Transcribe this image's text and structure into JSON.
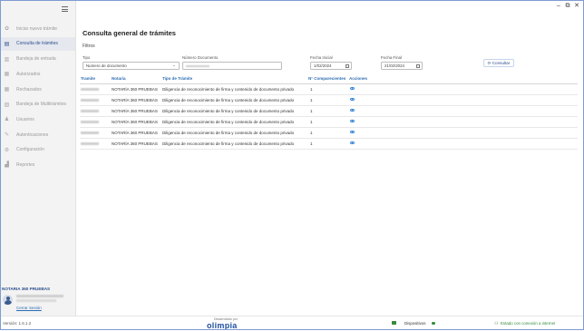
{
  "window": {
    "minimize": "–",
    "maximize": "⧉",
    "close": "✕"
  },
  "sidebar": {
    "items": [
      {
        "label": "Iniciar nuevo trámite",
        "icon": "gear-plus-icon",
        "glyph": "✿",
        "active": false
      },
      {
        "label": "Consulta de trámites",
        "icon": "table-icon",
        "glyph": "▤",
        "active": true
      },
      {
        "label": "Bandeja de entrada",
        "icon": "inbox-icon",
        "glyph": "▥",
        "active": false
      },
      {
        "label": "Autorizados",
        "icon": "document-check-icon",
        "glyph": "▦",
        "active": false
      },
      {
        "label": "Rechazados",
        "icon": "document-x-icon",
        "glyph": "▦",
        "active": false
      },
      {
        "label": "Bandeja de Multitrámites",
        "icon": "documents-icon",
        "glyph": "▧",
        "active": false
      },
      {
        "label": "Usuarios",
        "icon": "user-icon",
        "glyph": "♟",
        "active": false
      },
      {
        "label": "Autenticaciones",
        "icon": "fingerprint-icon",
        "glyph": "✎",
        "active": false
      },
      {
        "label": "Configuración",
        "icon": "gear-icon",
        "glyph": "⚙",
        "active": false
      },
      {
        "label": "Reportes",
        "icon": "bar-chart-icon",
        "glyph": "▟",
        "active": false
      }
    ],
    "user": {
      "notary": "NOTARIA 360 PRUEBAS",
      "logout": "Cerrar Sesión"
    }
  },
  "main": {
    "title": "Consulta general de trámites",
    "filters_label": "Filtros",
    "filters": {
      "tipo_label": "Tipo",
      "tipo_value": "Numero de documento",
      "numero_label": "Número Documento",
      "fecha_inicial_label": "Fecha Inicial",
      "fecha_inicial_value": "1/02/2024",
      "fecha_final_label": "Fecha Final",
      "fecha_final_value": "21/02/2024",
      "consult_button": "Consultar"
    },
    "table": {
      "headers": [
        "Tramite",
        "Notaria",
        "Tipo de Trámite",
        "N° Comparecientes",
        "Acciones"
      ],
      "rows": [
        {
          "notaria": "NOTARÍA 360 PRUEBAS",
          "tipo": "Diligencia de reconocimiento de firma y contenido de documento privado",
          "comparecientes": "1"
        },
        {
          "notaria": "NOTARÍA 360 PRUEBAS",
          "tipo": "Diligencia de reconocimiento de firma y contenido de documento privado",
          "comparecientes": "1"
        },
        {
          "notaria": "NOTARÍA 360 PRUEBAS",
          "tipo": "Diligencia de reconocimiento de firma y contenido de documento privado",
          "comparecientes": "1"
        },
        {
          "notaria": "NOTARÍA 360 PRUEBAS",
          "tipo": "Diligencia de reconocimiento de firma y contenido de documento privado",
          "comparecientes": "1"
        },
        {
          "notaria": "NOTARÍA 360 PRUEBAS",
          "tipo": "Diligencia de reconocimiento de firma y contenido de documento privado",
          "comparecientes": "1"
        },
        {
          "notaria": "NOTARÍA 360 PRUEBAS",
          "tipo": "Diligencia de reconocimiento de firma y contenido de documento privado",
          "comparecientes": "1"
        }
      ]
    }
  },
  "footer": {
    "version": "Versión: 1.6.1.2",
    "developed_by": "Desarrollado por",
    "logo": "olimpia",
    "devices": "Dispositivos",
    "connection": "Estado con conexión a internet"
  },
  "colors": {
    "accent": "#2b4f8e",
    "link": "#2b6cb0",
    "status_ok": "#2e8b3e"
  }
}
